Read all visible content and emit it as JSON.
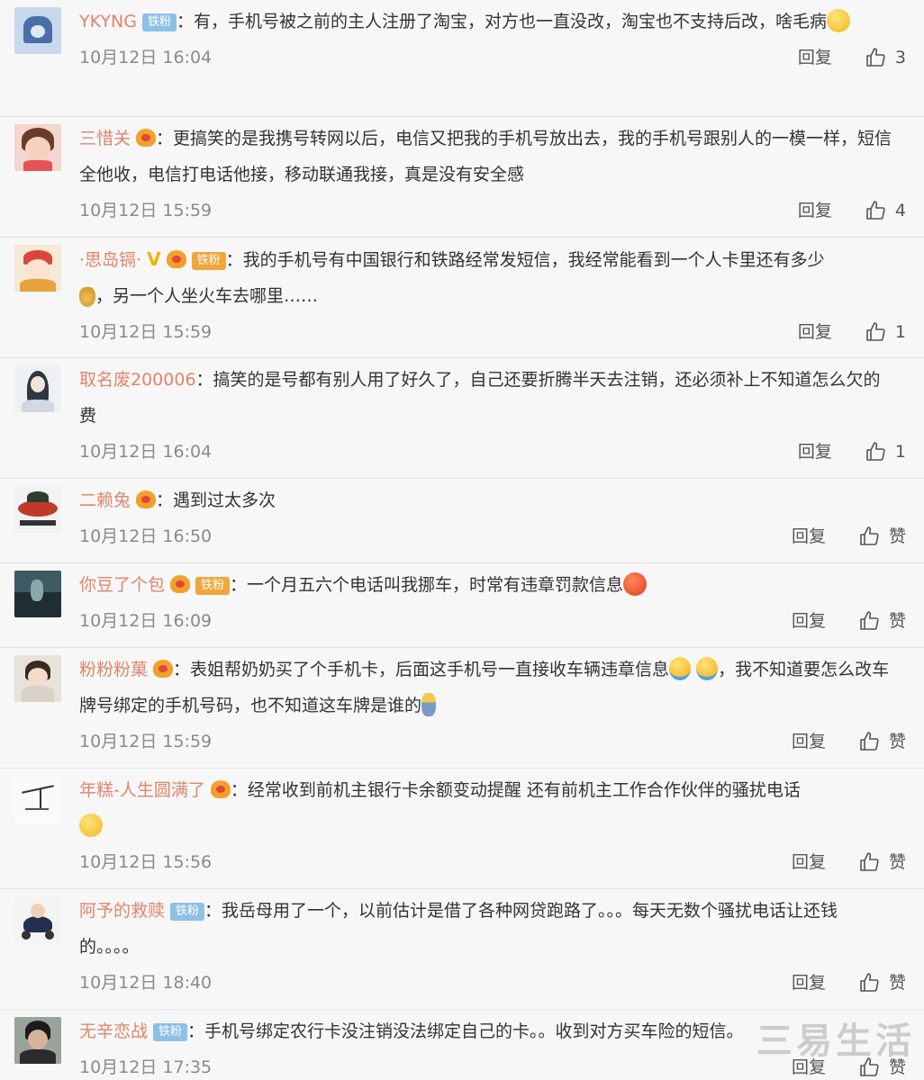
{
  "comments": [
    {
      "username": "YKYNG",
      "fan_badge": "铁粉",
      "text": "：有，手机号被之前的主人注册了淘宝，对方也一直没改，淘宝也不支持后改，啥毛病",
      "time": "10月12日 16:04",
      "reply": "回复",
      "likes": "3"
    },
    {
      "username": "三惜关",
      "text": "：更搞笑的是我携号转网以后，电信又把我的手机号放出去，我的手机号跟别人的一模一样，短信全他收，电信打电话他接，移动联通我接，真是没有安全感",
      "time": "10月12日 15:59",
      "reply": "回复",
      "likes": "4"
    },
    {
      "username": "·思岛镉·",
      "fan_badge": "铁粉",
      "text": "：我的手机号有中国银行和铁路经常发短信，我经常能看到一个人卡里还有多少",
      "text2": "，另一个人坐火车去哪里……",
      "time": "10月12日 15:59",
      "reply": "回复",
      "likes": "1"
    },
    {
      "username": "取名废200006",
      "text": "：搞笑的是号都有别人用了好久了，自己还要折腾半天去注销，还必须补上不知道怎么欠的费",
      "time": "10月12日 16:04",
      "reply": "回复",
      "likes": "1"
    },
    {
      "username": "二赖兔",
      "text": "：遇到过太多次",
      "time": "10月12日 16:50",
      "reply": "回复",
      "likes": "赞"
    },
    {
      "username": "你豆了个包",
      "fan_badge": "铁粉",
      "text": "：一个月五六个电话叫我挪车，时常有违章罚款信息",
      "time": "10月12日 16:09",
      "reply": "回复",
      "likes": "赞"
    },
    {
      "username": "粉粉粉菓",
      "text": "：表姐帮奶奶买了个手机卡，后面这手机号一直接收车辆违章信息",
      "text2": "，我不知道要怎么改车牌号绑定的手机号码，也不知道这车牌是谁的",
      "time": "10月12日 15:59",
      "reply": "回复",
      "likes": "赞"
    },
    {
      "username": "年糕-人生圆满了",
      "text": "：经常收到前机主银行卡余额变动提醒 还有前机主工作合作伙伴的骚扰电话",
      "time": "10月12日 15:56",
      "reply": "回复",
      "likes": "赞"
    },
    {
      "username": "阿予的救赎",
      "fan_badge": "铁粉",
      "text": "：我岳母用了一个，以前估计是借了各种网贷跑路了。。。每天无数个骚扰电话让还钱的。。。。",
      "time": "10月12日 18:40",
      "reply": "回复",
      "likes": "赞"
    },
    {
      "username": "无辛恋战",
      "fan_badge": "铁粉",
      "text": "：手机号绑定农行卡没注销没法绑定自己的卡。。收到对方买车险的短信。",
      "time": "10月12日 17:35",
      "reply": "回复",
      "likes": "赞"
    }
  ],
  "watermark": "三易生活",
  "colors": {
    "username": "#e2846b",
    "fan_badge": "#8ec0e6",
    "background": "#f7f7f7",
    "meta": "#8a8a8a"
  }
}
